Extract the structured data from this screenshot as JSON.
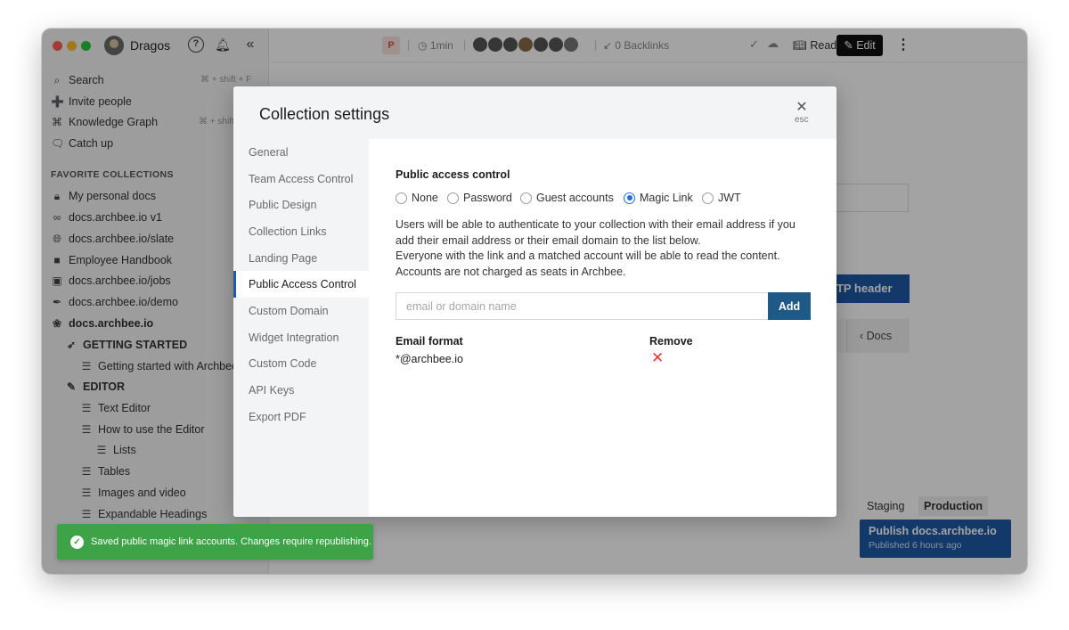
{
  "sidebar": {
    "user_name": "Dragos",
    "nav": [
      {
        "label": "Search",
        "icon": "search-icon",
        "shortcut": "⌘ + shift + F"
      },
      {
        "label": "Invite people",
        "icon": "invite-user-icon"
      },
      {
        "label": "Knowledge Graph",
        "icon": "graph-icon",
        "shortcut": "⌘ + shift"
      },
      {
        "label": "Catch up",
        "icon": "catch-up-icon"
      }
    ],
    "favorites_title": "FAVORITE COLLECTIONS",
    "collections": [
      "My personal docs",
      "docs.archbee.io v1",
      "docs.archbee.io/slate",
      "Employee Handbook",
      "docs.archbee.io/jobs",
      "docs.archbee.io/demo",
      "docs.archbee.io"
    ],
    "tree": [
      {
        "label": "GETTING STARTED",
        "level": 1
      },
      {
        "label": "Getting started with Archbee",
        "level": 2
      },
      {
        "label": "EDITOR",
        "level": 1
      },
      {
        "label": "Text Editor",
        "level": 2
      },
      {
        "label": "How to use the Editor",
        "level": 2
      },
      {
        "label": "Lists",
        "level": 3
      },
      {
        "label": "Tables",
        "level": 2
      },
      {
        "label": "Images and video",
        "level": 2
      },
      {
        "label": "Expandable Headings",
        "level": 2
      }
    ]
  },
  "topbar": {
    "badge": "P",
    "reading_time": "1min",
    "backlinks": "0 Backlinks",
    "read_label": "Read",
    "edit_label": "Edit"
  },
  "background": {
    "header_button": "TTP header",
    "docs_button": "Docs",
    "env_staging": "Staging",
    "env_production": "Production",
    "publish_title": "Publish docs.archbee.io",
    "publish_sub": "Published 6 hours ago"
  },
  "modal": {
    "title": "Collection settings",
    "close_label": "esc",
    "menu": [
      "General",
      "Team Access Control",
      "Public Design",
      "Collection Links",
      "Landing Page",
      "Public Access Control",
      "Custom Domain",
      "Widget Integration",
      "Custom Code",
      "API Keys",
      "Export PDF"
    ],
    "active_index": 5,
    "section_title": "Public access control",
    "options": [
      "None",
      "Password",
      "Guest accounts",
      "Magic Link",
      "JWT"
    ],
    "selected_option": "Magic Link",
    "description_lines": [
      "Users will be able to authenticate to your collection with their email address if you",
      "add their email address or their email domain to the list below.",
      "Everyone with the link and a matched account will be able to read the content.",
      "Accounts are not charged as seats in Archbee."
    ],
    "input_placeholder": "email or domain name",
    "add_label": "Add",
    "col_email": "Email format",
    "col_remove": "Remove",
    "rows": [
      {
        "email": "*@archbee.io"
      }
    ]
  },
  "toast": {
    "message": "Saved public magic link accounts. Changes require republishing."
  },
  "colors": {
    "accent": "#1e5aa8",
    "add_button": "#1f5985",
    "toast": "#3ea346",
    "remove": "#e53935"
  }
}
